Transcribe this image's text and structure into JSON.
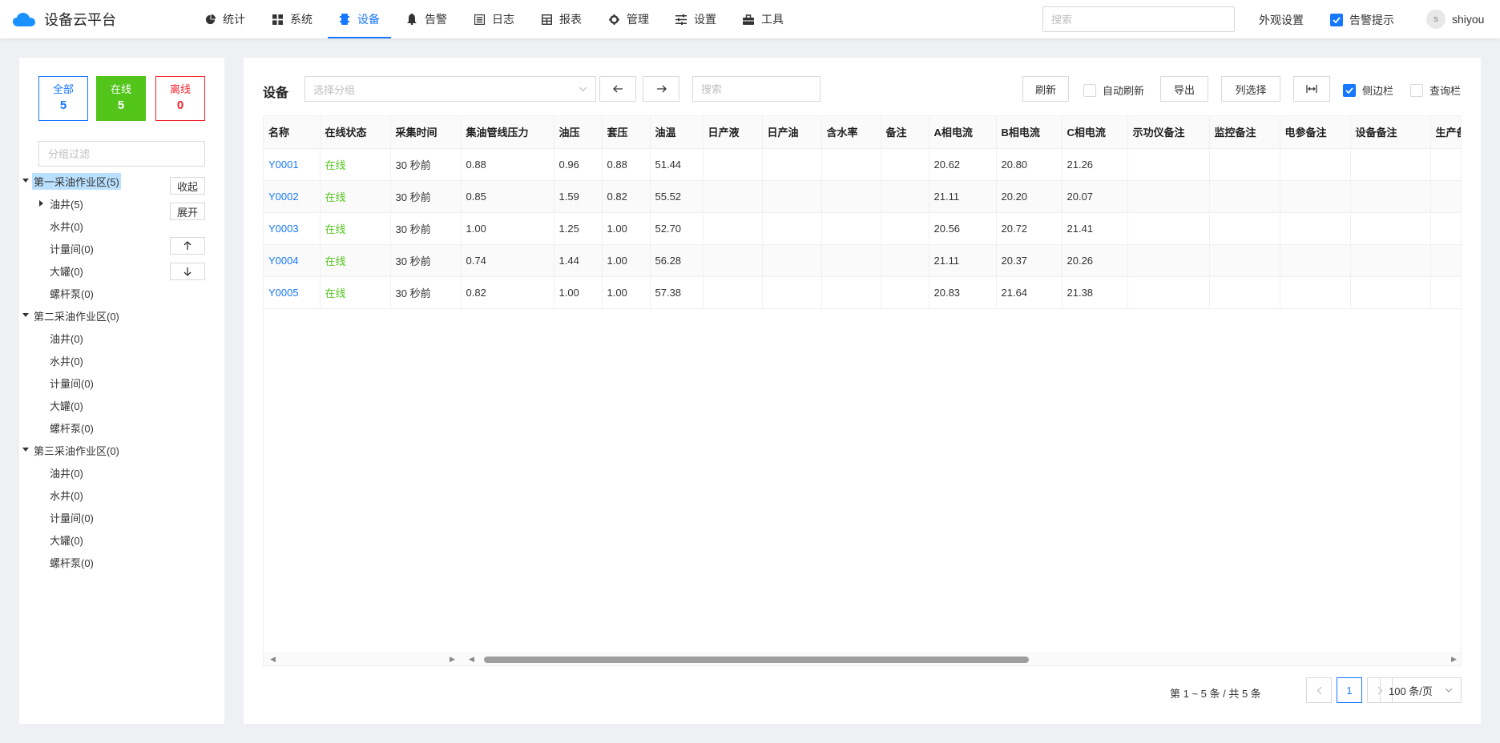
{
  "app": {
    "title": "设备云平台"
  },
  "nav": [
    {
      "label": "统计",
      "icon": "pie-chart-icon"
    },
    {
      "label": "系统",
      "icon": "grid-icon"
    },
    {
      "label": "设备",
      "icon": "device-icon",
      "active": true
    },
    {
      "label": "告警",
      "icon": "bell-icon"
    },
    {
      "label": "日志",
      "icon": "log-icon"
    },
    {
      "label": "报表",
      "icon": "table-icon"
    },
    {
      "label": "管理",
      "icon": "gear-icon"
    },
    {
      "label": "设置",
      "icon": "sliders-icon"
    },
    {
      "label": "工具",
      "icon": "toolbox-icon"
    }
  ],
  "header": {
    "search_placeholder": "搜索",
    "appearance_label": "外观设置",
    "alarm_hint_label": "告警提示",
    "user_initial": "s",
    "user_name": "shiyou"
  },
  "sidebar": {
    "stats": {
      "all_label": "全部",
      "all_count": "5",
      "online_label": "在线",
      "online_count": "5",
      "offline_label": "离线",
      "offline_count": "0"
    },
    "filter_placeholder": "分组过滤",
    "collapse_label": "收起",
    "expand_label": "展开",
    "tree": [
      {
        "label": "第一采油作业区(5)",
        "level": 0,
        "expanded": true,
        "selected": true
      },
      {
        "label": "油井(5)",
        "level": 1,
        "collapsed": true
      },
      {
        "label": "水井(0)",
        "level": 1
      },
      {
        "label": "计量间(0)",
        "level": 1
      },
      {
        "label": "大罐(0)",
        "level": 1
      },
      {
        "label": "螺杆泵(0)",
        "level": 1
      },
      {
        "label": "第二采油作业区(0)",
        "level": 0,
        "expanded": true
      },
      {
        "label": "油井(0)",
        "level": 1
      },
      {
        "label": "水井(0)",
        "level": 1
      },
      {
        "label": "计量间(0)",
        "level": 1
      },
      {
        "label": "大罐(0)",
        "level": 1
      },
      {
        "label": "螺杆泵(0)",
        "level": 1
      },
      {
        "label": "第三采油作业区(0)",
        "level": 0,
        "expanded": true
      },
      {
        "label": "油井(0)",
        "level": 1
      },
      {
        "label": "水井(0)",
        "level": 1
      },
      {
        "label": "计量间(0)",
        "level": 1
      },
      {
        "label": "大罐(0)",
        "level": 1
      },
      {
        "label": "螺杆泵(0)",
        "level": 1
      }
    ]
  },
  "toolbar": {
    "title": "设备",
    "group_placeholder": "选择分组",
    "search_placeholder": "搜索",
    "refresh_label": "刷新",
    "auto_refresh_label": "自动刷新",
    "export_label": "导出",
    "column_select_label": "列选择",
    "sidebar_label": "侧边栏",
    "query_bar_label": "查询栏"
  },
  "table": {
    "columns": [
      "名称",
      "在线状态",
      "采集时间",
      "集油管线压力",
      "油压",
      "套压",
      "油温",
      "日产液",
      "日产油",
      "含水率",
      "备注",
      "A相电流",
      "B相电流",
      "C相电流",
      "示功仪备注",
      "监控备注",
      "电参备注",
      "设备备注",
      "生产备注"
    ],
    "rows": [
      [
        "Y0001",
        "在线",
        "30 秒前",
        "0.88",
        "0.96",
        "0.88",
        "51.44",
        "",
        "",
        "",
        "",
        "20.62",
        "20.80",
        "21.26",
        "",
        "",
        "",
        "",
        ""
      ],
      [
        "Y0002",
        "在线",
        "30 秒前",
        "0.85",
        "1.59",
        "0.82",
        "55.52",
        "",
        "",
        "",
        "",
        "21.11",
        "20.20",
        "20.07",
        "",
        "",
        "",
        "",
        ""
      ],
      [
        "Y0003",
        "在线",
        "30 秒前",
        "1.00",
        "1.25",
        "1.00",
        "52.70",
        "",
        "",
        "",
        "",
        "20.56",
        "20.72",
        "21.41",
        "",
        "",
        "",
        "",
        ""
      ],
      [
        "Y0004",
        "在线",
        "30 秒前",
        "0.74",
        "1.44",
        "1.00",
        "56.28",
        "",
        "",
        "",
        "",
        "21.11",
        "20.37",
        "20.26",
        "",
        "",
        "",
        "",
        ""
      ],
      [
        "Y0005",
        "在线",
        "30 秒前",
        "0.82",
        "1.00",
        "1.00",
        "57.38",
        "",
        "",
        "",
        "",
        "20.83",
        "21.64",
        "21.38",
        "",
        "",
        "",
        "",
        ""
      ]
    ]
  },
  "pagination": {
    "total_text": "第 1 ~ 5 条 / 共 5 条",
    "current_page": "1",
    "page_size": "100 条/页"
  },
  "colors": {
    "primary": "#1677ff",
    "online": "#52c41a",
    "offline": "#f5222d"
  }
}
